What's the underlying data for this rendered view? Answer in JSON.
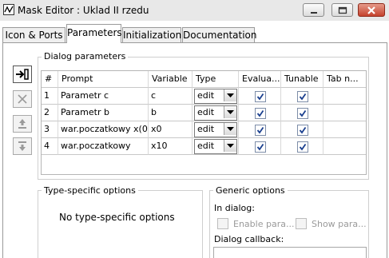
{
  "window": {
    "title": "Mask Editor : Uklad II rzedu",
    "icon": "mask-editor-icon",
    "controls": {
      "minimize_icon": "minimize-icon",
      "maximize_icon": "maximize-icon",
      "close_icon": "close-icon"
    }
  },
  "tabs": [
    {
      "label": "Icon & Ports",
      "active": false
    },
    {
      "label": "Parameters",
      "active": true
    },
    {
      "label": "Initialization",
      "active": false
    },
    {
      "label": "Documentation",
      "active": false
    }
  ],
  "side_buttons": [
    {
      "name": "add-parameter-button",
      "icon": "add-row-icon",
      "enabled": true
    },
    {
      "name": "delete-parameter-button",
      "icon": "delete-x-icon",
      "enabled": false
    },
    {
      "name": "move-up-button",
      "icon": "move-up-icon",
      "enabled": false
    },
    {
      "name": "move-down-button",
      "icon": "move-down-icon",
      "enabled": false
    }
  ],
  "dialog_parameters": {
    "label": "Dialog parameters",
    "columns": [
      "#",
      "Prompt",
      "Variable",
      "Type",
      "Evalua...",
      "Tunable",
      "Tab n..."
    ],
    "rows": [
      {
        "num": "1",
        "prompt": "Parametr c",
        "variable": "c",
        "type": "edit",
        "evaluate": true,
        "tunable": true,
        "tab": ""
      },
      {
        "num": "2",
        "prompt": "Parametr b",
        "variable": "b",
        "type": "edit",
        "evaluate": true,
        "tunable": true,
        "tab": ""
      },
      {
        "num": "3",
        "prompt": "war.poczatkowy x(0)",
        "variable": "x0",
        "type": "edit",
        "evaluate": true,
        "tunable": true,
        "tab": ""
      },
      {
        "num": "4",
        "prompt": "war.poczatkowy",
        "variable": "x10",
        "type": "edit",
        "evaluate": true,
        "tunable": true,
        "tab": ""
      }
    ]
  },
  "type_specific": {
    "label": "Type-specific options",
    "message": "No type-specific options"
  },
  "generic_options": {
    "label": "Generic options",
    "in_dialog_label": "In dialog:",
    "enable_parameter": {
      "label": "Enable para...",
      "checked": false,
      "enabled": false
    },
    "show_parameter": {
      "label": "Show para...",
      "checked": false,
      "enabled": false
    },
    "callback_label": "Dialog callback:",
    "callback_value": ""
  },
  "colors": {
    "accent_close": "#c5422d",
    "checkbox_border": "#7d8da8",
    "check_mark": "#1a3f8f"
  }
}
